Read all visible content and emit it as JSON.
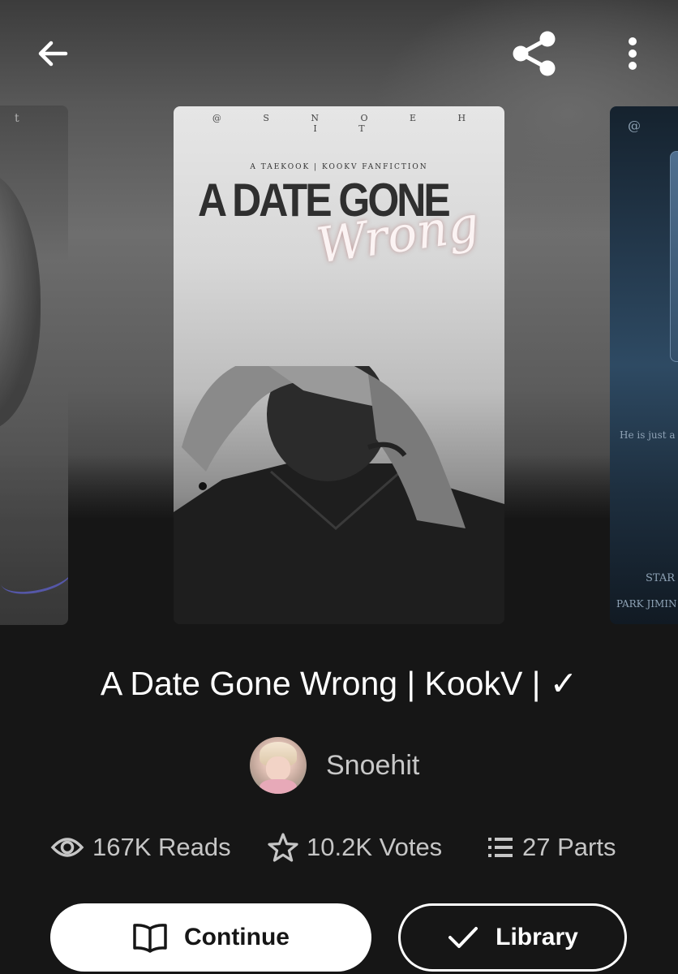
{
  "topbar": {
    "back_icon": "arrow-left-icon",
    "share_icon": "share-icon",
    "more_icon": "more-vertical-icon"
  },
  "covers": {
    "left": {
      "corner_text": "t"
    },
    "main": {
      "author_spaced": "@ S N O E H I T",
      "tagline": "A TAEKOOK | KOOKV FANFICTION",
      "title_block": "A DATE GONE",
      "title_script": "Wrong"
    },
    "right": {
      "corner_text": "@",
      "line1": "He is just a",
      "line2": "STAR",
      "line3": "PARK JIMIN |"
    }
  },
  "book": {
    "title": "A Date Gone Wrong | KookV | ✓",
    "author": "Snoehit"
  },
  "stats": {
    "reads": "167K Reads",
    "votes": "10.2K Votes",
    "parts": "27 Parts"
  },
  "actions": {
    "continue_label": "Continue",
    "library_label": "Library"
  },
  "colors": {
    "background": "#161616",
    "text_primary": "#ffffff",
    "text_secondary": "#c6c6c6"
  }
}
